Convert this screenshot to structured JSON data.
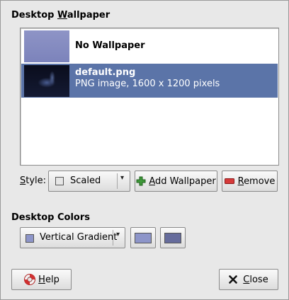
{
  "wallpaper_section": {
    "title_prefix": "Desktop ",
    "title_mnemonic": "W",
    "title_suffix": "allpaper"
  },
  "wallpapers": [
    {
      "name": "No Wallpaper",
      "description": "",
      "selected": false
    },
    {
      "name": "default.png",
      "description": "PNG image, 1600 x 1200 pixels",
      "selected": true
    }
  ],
  "style": {
    "label_mnemonic": "S",
    "label_rest": "tyle:",
    "value": "Scaled"
  },
  "buttons": {
    "add_wallpaper_mnemonic": "A",
    "add_wallpaper_rest": "dd Wallpaper",
    "remove_mnemonic": "R",
    "remove_rest": "emove",
    "help_mnemonic": "H",
    "help_rest": "elp",
    "close_mnemonic": "C",
    "close_rest": "lose"
  },
  "colors_section": {
    "title": "Desktop Colors",
    "gradient_value": "Vertical Gradient",
    "primary_color": "#8d95c9",
    "secondary_color": "#666c9c"
  },
  "icons": {
    "style_combo": "frame-icon",
    "add": "plus-icon",
    "remove": "minus-icon",
    "help": "lifebuoy-icon",
    "close": "close-icon"
  }
}
